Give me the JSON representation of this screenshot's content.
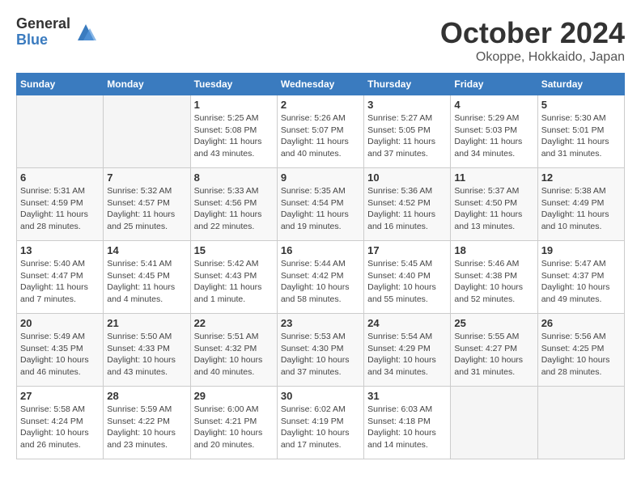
{
  "header": {
    "logo_general": "General",
    "logo_blue": "Blue",
    "month_title": "October 2024",
    "location": "Okoppe, Hokkaido, Japan"
  },
  "weekdays": [
    "Sunday",
    "Monday",
    "Tuesday",
    "Wednesday",
    "Thursday",
    "Friday",
    "Saturday"
  ],
  "weeks": [
    [
      {
        "day": "",
        "sunrise": "",
        "sunset": "",
        "daylight": ""
      },
      {
        "day": "",
        "sunrise": "",
        "sunset": "",
        "daylight": ""
      },
      {
        "day": "1",
        "sunrise": "Sunrise: 5:25 AM",
        "sunset": "Sunset: 5:08 PM",
        "daylight": "Daylight: 11 hours and 43 minutes."
      },
      {
        "day": "2",
        "sunrise": "Sunrise: 5:26 AM",
        "sunset": "Sunset: 5:07 PM",
        "daylight": "Daylight: 11 hours and 40 minutes."
      },
      {
        "day": "3",
        "sunrise": "Sunrise: 5:27 AM",
        "sunset": "Sunset: 5:05 PM",
        "daylight": "Daylight: 11 hours and 37 minutes."
      },
      {
        "day": "4",
        "sunrise": "Sunrise: 5:29 AM",
        "sunset": "Sunset: 5:03 PM",
        "daylight": "Daylight: 11 hours and 34 minutes."
      },
      {
        "day": "5",
        "sunrise": "Sunrise: 5:30 AM",
        "sunset": "Sunset: 5:01 PM",
        "daylight": "Daylight: 11 hours and 31 minutes."
      }
    ],
    [
      {
        "day": "6",
        "sunrise": "Sunrise: 5:31 AM",
        "sunset": "Sunset: 4:59 PM",
        "daylight": "Daylight: 11 hours and 28 minutes."
      },
      {
        "day": "7",
        "sunrise": "Sunrise: 5:32 AM",
        "sunset": "Sunset: 4:57 PM",
        "daylight": "Daylight: 11 hours and 25 minutes."
      },
      {
        "day": "8",
        "sunrise": "Sunrise: 5:33 AM",
        "sunset": "Sunset: 4:56 PM",
        "daylight": "Daylight: 11 hours and 22 minutes."
      },
      {
        "day": "9",
        "sunrise": "Sunrise: 5:35 AM",
        "sunset": "Sunset: 4:54 PM",
        "daylight": "Daylight: 11 hours and 19 minutes."
      },
      {
        "day": "10",
        "sunrise": "Sunrise: 5:36 AM",
        "sunset": "Sunset: 4:52 PM",
        "daylight": "Daylight: 11 hours and 16 minutes."
      },
      {
        "day": "11",
        "sunrise": "Sunrise: 5:37 AM",
        "sunset": "Sunset: 4:50 PM",
        "daylight": "Daylight: 11 hours and 13 minutes."
      },
      {
        "day": "12",
        "sunrise": "Sunrise: 5:38 AM",
        "sunset": "Sunset: 4:49 PM",
        "daylight": "Daylight: 11 hours and 10 minutes."
      }
    ],
    [
      {
        "day": "13",
        "sunrise": "Sunrise: 5:40 AM",
        "sunset": "Sunset: 4:47 PM",
        "daylight": "Daylight: 11 hours and 7 minutes."
      },
      {
        "day": "14",
        "sunrise": "Sunrise: 5:41 AM",
        "sunset": "Sunset: 4:45 PM",
        "daylight": "Daylight: 11 hours and 4 minutes."
      },
      {
        "day": "15",
        "sunrise": "Sunrise: 5:42 AM",
        "sunset": "Sunset: 4:43 PM",
        "daylight": "Daylight: 11 hours and 1 minute."
      },
      {
        "day": "16",
        "sunrise": "Sunrise: 5:44 AM",
        "sunset": "Sunset: 4:42 PM",
        "daylight": "Daylight: 10 hours and 58 minutes."
      },
      {
        "day": "17",
        "sunrise": "Sunrise: 5:45 AM",
        "sunset": "Sunset: 4:40 PM",
        "daylight": "Daylight: 10 hours and 55 minutes."
      },
      {
        "day": "18",
        "sunrise": "Sunrise: 5:46 AM",
        "sunset": "Sunset: 4:38 PM",
        "daylight": "Daylight: 10 hours and 52 minutes."
      },
      {
        "day": "19",
        "sunrise": "Sunrise: 5:47 AM",
        "sunset": "Sunset: 4:37 PM",
        "daylight": "Daylight: 10 hours and 49 minutes."
      }
    ],
    [
      {
        "day": "20",
        "sunrise": "Sunrise: 5:49 AM",
        "sunset": "Sunset: 4:35 PM",
        "daylight": "Daylight: 10 hours and 46 minutes."
      },
      {
        "day": "21",
        "sunrise": "Sunrise: 5:50 AM",
        "sunset": "Sunset: 4:33 PM",
        "daylight": "Daylight: 10 hours and 43 minutes."
      },
      {
        "day": "22",
        "sunrise": "Sunrise: 5:51 AM",
        "sunset": "Sunset: 4:32 PM",
        "daylight": "Daylight: 10 hours and 40 minutes."
      },
      {
        "day": "23",
        "sunrise": "Sunrise: 5:53 AM",
        "sunset": "Sunset: 4:30 PM",
        "daylight": "Daylight: 10 hours and 37 minutes."
      },
      {
        "day": "24",
        "sunrise": "Sunrise: 5:54 AM",
        "sunset": "Sunset: 4:29 PM",
        "daylight": "Daylight: 10 hours and 34 minutes."
      },
      {
        "day": "25",
        "sunrise": "Sunrise: 5:55 AM",
        "sunset": "Sunset: 4:27 PM",
        "daylight": "Daylight: 10 hours and 31 minutes."
      },
      {
        "day": "26",
        "sunrise": "Sunrise: 5:56 AM",
        "sunset": "Sunset: 4:25 PM",
        "daylight": "Daylight: 10 hours and 28 minutes."
      }
    ],
    [
      {
        "day": "27",
        "sunrise": "Sunrise: 5:58 AM",
        "sunset": "Sunset: 4:24 PM",
        "daylight": "Daylight: 10 hours and 26 minutes."
      },
      {
        "day": "28",
        "sunrise": "Sunrise: 5:59 AM",
        "sunset": "Sunset: 4:22 PM",
        "daylight": "Daylight: 10 hours and 23 minutes."
      },
      {
        "day": "29",
        "sunrise": "Sunrise: 6:00 AM",
        "sunset": "Sunset: 4:21 PM",
        "daylight": "Daylight: 10 hours and 20 minutes."
      },
      {
        "day": "30",
        "sunrise": "Sunrise: 6:02 AM",
        "sunset": "Sunset: 4:19 PM",
        "daylight": "Daylight: 10 hours and 17 minutes."
      },
      {
        "day": "31",
        "sunrise": "Sunrise: 6:03 AM",
        "sunset": "Sunset: 4:18 PM",
        "daylight": "Daylight: 10 hours and 14 minutes."
      },
      {
        "day": "",
        "sunrise": "",
        "sunset": "",
        "daylight": ""
      },
      {
        "day": "",
        "sunrise": "",
        "sunset": "",
        "daylight": ""
      }
    ]
  ]
}
